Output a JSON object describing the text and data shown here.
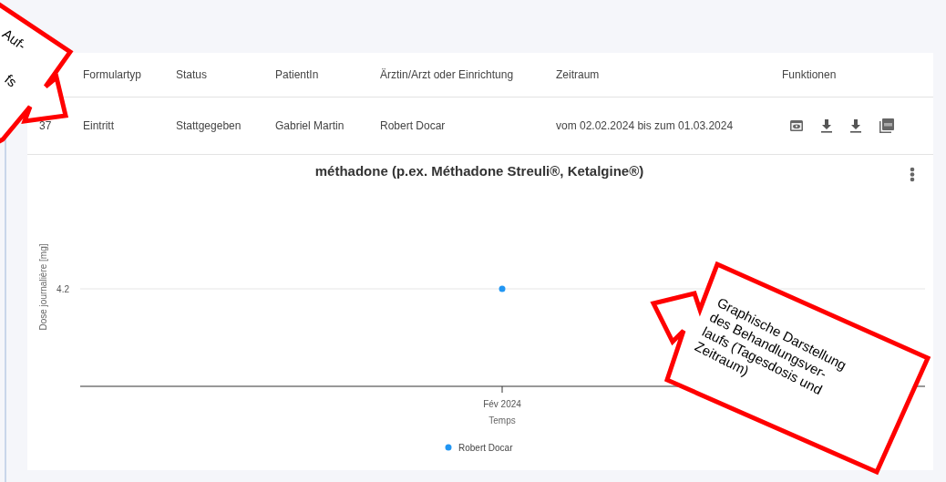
{
  "table": {
    "columns": [
      "Formulartyp",
      "Status",
      "PatientIn",
      "Ärztin/Arzt oder Einrichtung",
      "Zeitraum",
      "Funktionen"
    ],
    "rows": [
      {
        "number": "37",
        "cells": [
          "Eintritt",
          "Stattgegeben",
          "Gabriel Martin",
          "Robert Docar",
          "vom 02.02.2024 bis zum 01.03.2024"
        ],
        "actions": [
          {
            "kind": "view"
          },
          {
            "kind": "download"
          },
          {
            "kind": "download"
          },
          {
            "kind": "pdf"
          }
        ]
      }
    ]
  },
  "chart": {
    "title": "méthadone (p.ex. Méthadone Streuli®, Ketalgine®)",
    "y_axis_title": "Dose journalière [mg]",
    "y_tick": "4.2",
    "x_tick": "Fév 2024",
    "x_axis_title": "Temps",
    "legend": [
      {
        "name": "Robert Docar",
        "color": "#2196f3"
      }
    ]
  },
  "callouts": [
    {
      "lines": [
        "Auf-",
        "fs"
      ]
    },
    {
      "lines": [
        "Graphische Darstellung",
        "des Behandlungsver-",
        "laufs (Tagesdosis und",
        "Zeitraum)"
      ]
    }
  ]
}
